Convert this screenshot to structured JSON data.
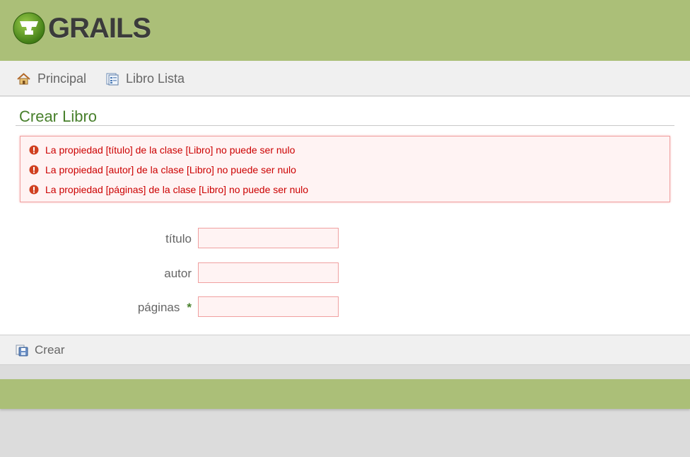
{
  "header": {
    "logo_text": "GRAILS"
  },
  "nav": {
    "items": [
      {
        "label": "Principal",
        "icon": "home-icon"
      },
      {
        "label": "Libro Lista",
        "icon": "list-icon"
      }
    ]
  },
  "page": {
    "title": "Crear Libro"
  },
  "errors": [
    "La propiedad [título] de la clase [Libro] no puede ser nulo",
    "La propiedad [autor] de la clase [Libro] no puede ser nulo",
    "La propiedad [páginas] de la clase [Libro] no puede ser nulo"
  ],
  "form": {
    "fields": [
      {
        "label": "título",
        "value": "",
        "required": false
      },
      {
        "label": "autor",
        "value": "",
        "required": false
      },
      {
        "label": "páginas",
        "value": "",
        "required": true,
        "required_mark": "*"
      }
    ]
  },
  "buttons": {
    "create_label": "Crear"
  },
  "colors": {
    "brand_green": "#abbf78",
    "title_green": "#48802c",
    "error_red": "#cc0000",
    "error_bg": "#fff3f3"
  }
}
